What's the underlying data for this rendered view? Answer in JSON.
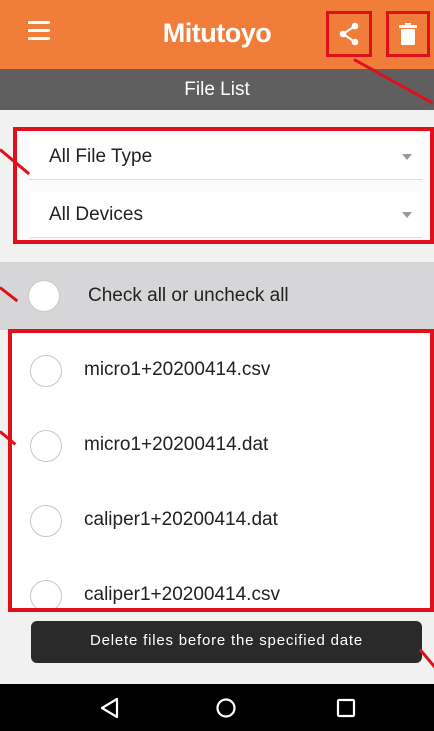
{
  "app": {
    "brand": "Mitutoyo",
    "subtitle": "File List"
  },
  "toolbar": {
    "menu_icon": "hamburger-menu-icon",
    "share_icon": "share-icon",
    "delete_icon": "trash-icon"
  },
  "filters": {
    "file_type": "All File Type",
    "devices": "All Devices"
  },
  "check_all": {
    "label": "Check all or uncheck all"
  },
  "files": [
    {
      "name": "micro1+20200414.csv"
    },
    {
      "name": "micro1+20200414.dat"
    },
    {
      "name": "caliper1+20200414.dat"
    },
    {
      "name": "caliper1+20200414.csv"
    }
  ],
  "actions": {
    "delete_before_date": "Delete files before the specified date"
  },
  "nav": {
    "back_icon": "back-triangle-icon",
    "home_icon": "home-circle-icon",
    "recents_icon": "recents-square-icon"
  },
  "colors": {
    "appbar": "#f07d3a",
    "subbar": "#5f5f5f",
    "annotation": "#e0101a"
  }
}
